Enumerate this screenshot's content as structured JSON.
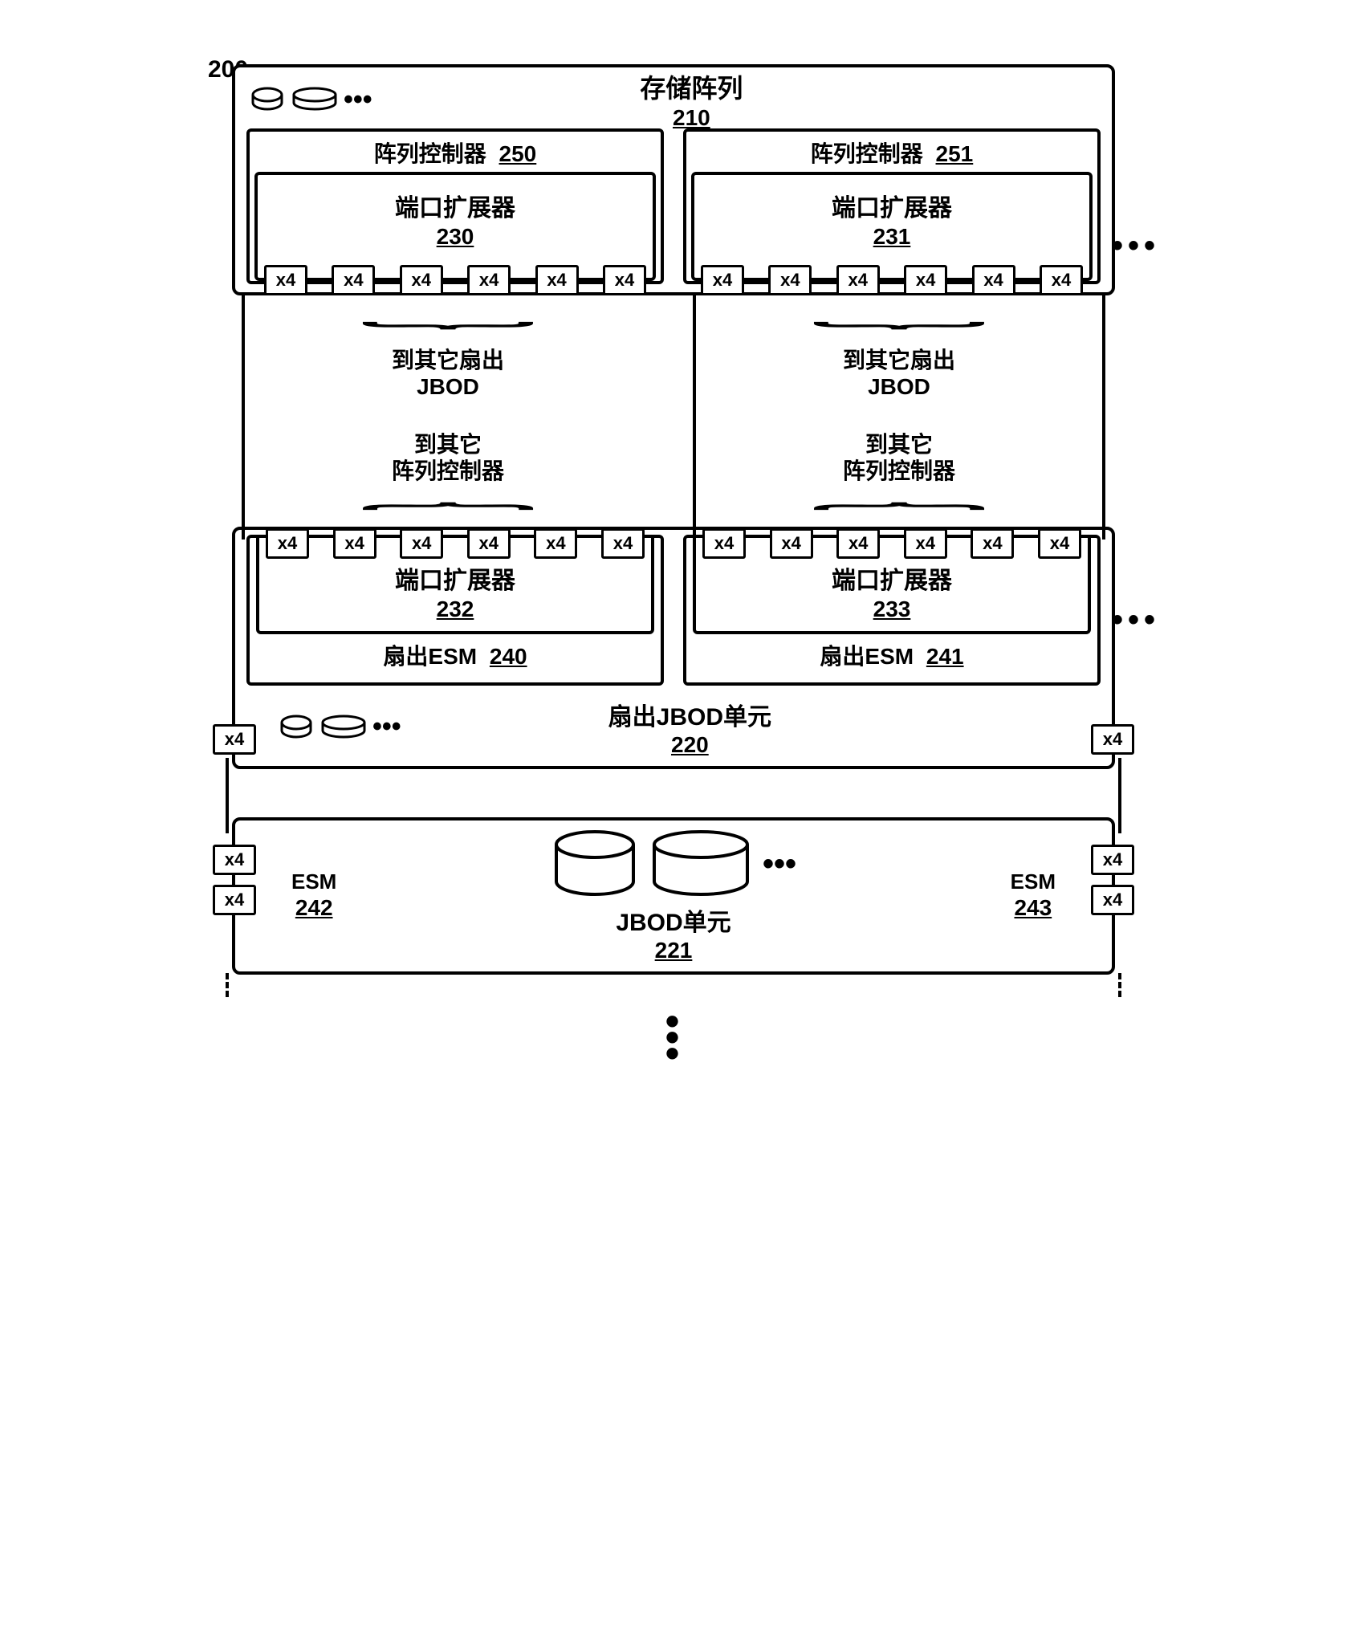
{
  "figure_ref": "200",
  "storage_array": {
    "title": "存储阵列",
    "ref": "210"
  },
  "controllers": [
    {
      "title": "阵列控制器",
      "ref": "250",
      "expander": {
        "title": "端口扩展器",
        "ref": "230"
      }
    },
    {
      "title": "阵列控制器",
      "ref": "251",
      "expander": {
        "title": "端口扩展器",
        "ref": "231"
      }
    }
  ],
  "port_label": "x4",
  "gap": {
    "fanout_text_l1": "到其它扇出",
    "fanout_text_l2": "JBOD",
    "ctrl_text_l1": "到其它",
    "ctrl_text_l2": "阵列控制器"
  },
  "esms": [
    {
      "expander": {
        "title": "端口扩展器",
        "ref": "232"
      },
      "title": "扇出ESM",
      "ref": "240"
    },
    {
      "expander": {
        "title": "端口扩展器",
        "ref": "233"
      },
      "title": "扇出ESM",
      "ref": "241"
    }
  ],
  "fanout_jbod": {
    "title": "扇出JBOD单元",
    "ref": "220"
  },
  "jbod_unit": {
    "title": "JBOD单元",
    "ref": "221",
    "esm_left": {
      "title": "ESM",
      "ref": "242"
    },
    "esm_right": {
      "title": "ESM",
      "ref": "243"
    }
  },
  "ellipsis": "...",
  "dots3": "•••",
  "dots_v": "⋮"
}
